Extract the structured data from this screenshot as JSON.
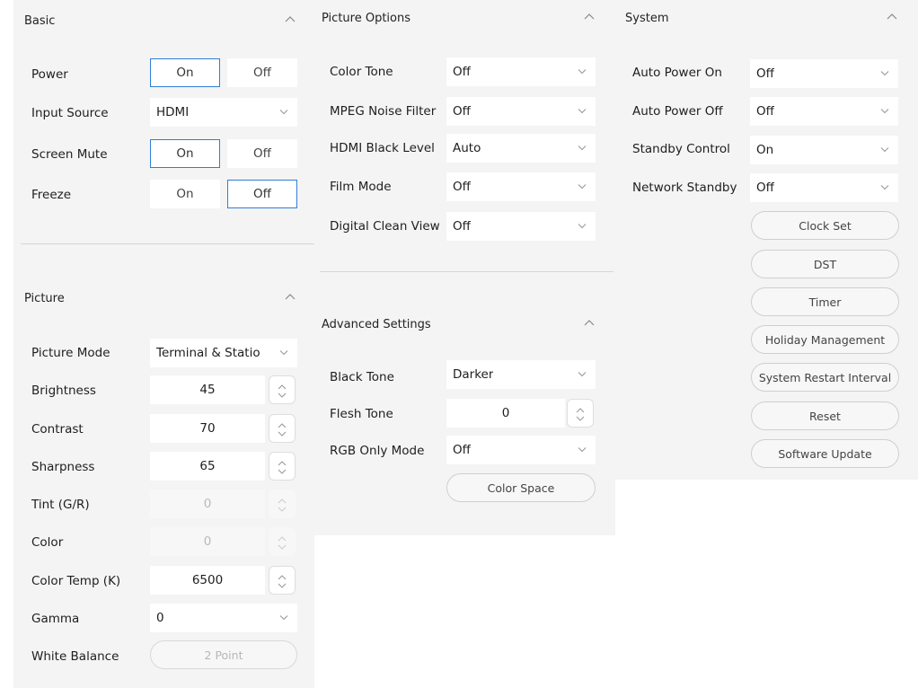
{
  "basic": {
    "title": "Basic",
    "power": {
      "label": "Power",
      "on": "On",
      "off": "Off"
    },
    "input_source": {
      "label": "Input Source",
      "value": "HDMI"
    },
    "screen_mute": {
      "label": "Screen Mute",
      "on": "On",
      "off": "Off"
    },
    "freeze": {
      "label": "Freeze",
      "on": "On",
      "off": "Off"
    }
  },
  "picture": {
    "title": "Picture",
    "picture_mode": {
      "label": "Picture Mode",
      "value": "Terminal & Statio"
    },
    "brightness": {
      "label": "Brightness",
      "value": "45"
    },
    "contrast": {
      "label": "Contrast",
      "value": "70"
    },
    "sharpness": {
      "label": "Sharpness",
      "value": "65"
    },
    "tint": {
      "label": "Tint (G/R)",
      "value": "0"
    },
    "color": {
      "label": "Color",
      "value": "0"
    },
    "color_temp": {
      "label": "Color Temp (K)",
      "value": "6500"
    },
    "gamma": {
      "label": "Gamma",
      "value": "0"
    },
    "white_balance": {
      "label": "White Balance",
      "button": "2 Point"
    }
  },
  "picture_options": {
    "title": "Picture Options",
    "color_tone": {
      "label": "Color Tone",
      "value": "Off"
    },
    "mpeg_noise": {
      "label": "MPEG Noise Filter",
      "value": "Off"
    },
    "hdmi_black": {
      "label": "HDMI Black Level",
      "value": "Auto"
    },
    "film_mode": {
      "label": "Film Mode",
      "value": "Off"
    },
    "digital_clean": {
      "label": "Digital Clean View",
      "value": "Off"
    }
  },
  "advanced": {
    "title": "Advanced Settings",
    "black_tone": {
      "label": "Black Tone",
      "value": "Darker"
    },
    "flesh_tone": {
      "label": "Flesh Tone",
      "value": "0"
    },
    "rgb_only": {
      "label": "RGB Only Mode",
      "value": "Off"
    },
    "color_space_button": "Color Space"
  },
  "system": {
    "title": "System",
    "auto_power_on": {
      "label": "Auto Power On",
      "value": "Off"
    },
    "auto_power_off": {
      "label": "Auto Power Off",
      "value": "Off"
    },
    "standby_control": {
      "label": "Standby Control",
      "value": "On"
    },
    "network_standby": {
      "label": "Network Standby",
      "value": "Off"
    },
    "buttons": {
      "clock_set": "Clock Set",
      "dst": "DST",
      "timer": "Timer",
      "holiday": "Holiday Management",
      "restart_interval": "System Restart Interval",
      "reset": "Reset",
      "software_update": "Software Update"
    }
  },
  "colors": {
    "panel_bg": "#f4f4f4",
    "selected_border": "#2e7fd6",
    "divider": "#d6d6d6"
  }
}
